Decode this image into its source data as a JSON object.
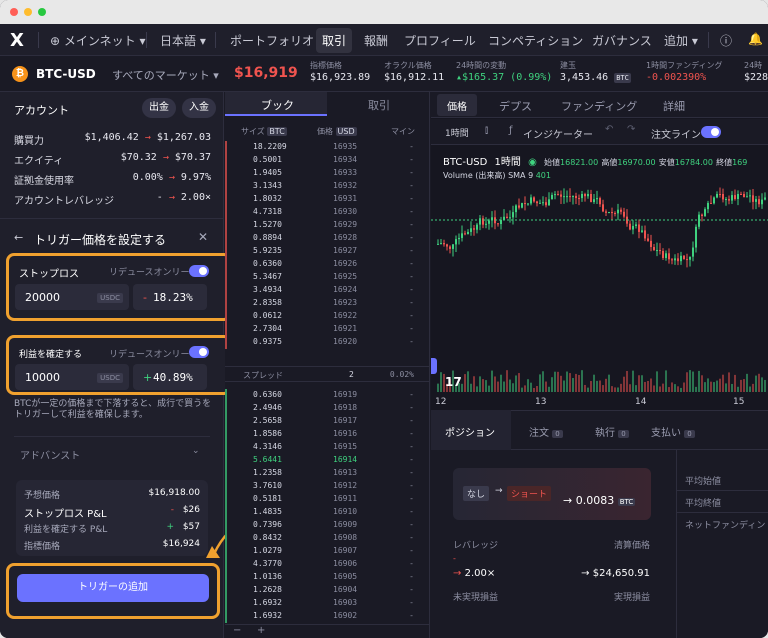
{
  "nav": {
    "network": "メインネット",
    "language": "日本語",
    "items": [
      "ポートフォリオ",
      "取引",
      "報酬",
      "プロフィール",
      "コンペティション",
      "ガバナンス",
      "追加"
    ]
  },
  "ticker": {
    "market": "BTC-USD",
    "all_markets": "すべてのマーケット",
    "price": "$16,919",
    "stats": [
      {
        "label": "指標価格",
        "value": "$16,923.89"
      },
      {
        "label": "オラクル価格",
        "value": "$16,912.11"
      },
      {
        "label": "24時間の変動",
        "value": "▴$165.37 (0.99%)"
      },
      {
        "label": "建玉",
        "value": "3,453.46",
        "unit": "BTC"
      },
      {
        "label": "1時間ファンディング",
        "value": "-0.002390%"
      },
      {
        "label": "24時",
        "value": "$228"
      }
    ]
  },
  "account": {
    "title": "アカウント",
    "withdraw": "出金",
    "deposit": "入金",
    "rows": [
      {
        "k": "購買力",
        "from": "$1,406.42",
        "to": "$1,267.03"
      },
      {
        "k": "エクイティ",
        "from": "$70.32",
        "to": "$70.37"
      },
      {
        "k": "証拠金使用率",
        "from": "0.00%",
        "to": "9.97%"
      },
      {
        "k": "アカウントレバレッジ",
        "from": "-",
        "to": "2.00×"
      }
    ]
  },
  "trigger": {
    "title": "トリガー価格を設定する",
    "stop": {
      "label": "ストップロス",
      "reduce": "リデュースオンリー",
      "value": "20000",
      "unit": "USDC",
      "pct": "18.23%",
      "sign": "-"
    },
    "take": {
      "label": "利益を確定する",
      "reduce": "リデュースオンリー",
      "value": "10000",
      "unit": "USDC",
      "pct": "40.89%",
      "sign": "+"
    },
    "info": "BTCが一定の価格まで下落すると、成行で買うをトリガーして利益を確保します。",
    "advanced": "アドバンスト",
    "summary": [
      {
        "k": "予想価格",
        "v": "$16,918.00"
      },
      {
        "k": "ストップロス P&L",
        "v": "$26",
        "s": "-"
      },
      {
        "k": "利益を確定する P&L",
        "v": "$57",
        "s": "+"
      },
      {
        "k": "指標価格",
        "v": "$16,924"
      }
    ],
    "add": "トリガーの追加"
  },
  "book": {
    "tabs": [
      "ブック",
      "取引"
    ],
    "headers": [
      "サイズ",
      "価格",
      "マイン"
    ],
    "size_unit": "BTC",
    "price_unit": "USD",
    "asks": [
      [
        "18.2209",
        "16935"
      ],
      [
        "0.5001",
        "16934"
      ],
      [
        "1.9405",
        "16933"
      ],
      [
        "3.1343",
        "16932"
      ],
      [
        "1.8032",
        "16931"
      ],
      [
        "4.7318",
        "16930"
      ],
      [
        "1.5270",
        "16929"
      ],
      [
        "0.8894",
        "16928"
      ],
      [
        "5.9235",
        "16927"
      ],
      [
        "0.6360",
        "16926"
      ],
      [
        "5.3467",
        "16925"
      ],
      [
        "3.4934",
        "16924"
      ],
      [
        "2.8358",
        "16923"
      ],
      [
        "0.0612",
        "16922"
      ],
      [
        "2.7304",
        "16921"
      ],
      [
        "0.9375",
        "16920"
      ]
    ],
    "spread": {
      "label": "スプレッド",
      "value": "2",
      "pct": "0.02%"
    },
    "bids": [
      [
        "0.6360",
        "16919"
      ],
      [
        "2.4946",
        "16918"
      ],
      [
        "2.5658",
        "16917"
      ],
      [
        "1.8586",
        "16916"
      ],
      [
        "4.3146",
        "16915"
      ],
      [
        "5.6441",
        "16914"
      ],
      [
        "1.2358",
        "16913"
      ],
      [
        "3.7610",
        "16912"
      ],
      [
        "0.5181",
        "16911"
      ],
      [
        "1.4835",
        "16910"
      ],
      [
        "0.7396",
        "16909"
      ],
      [
        "0.8432",
        "16908"
      ],
      [
        "1.0279",
        "16907"
      ],
      [
        "4.3770",
        "16906"
      ],
      [
        "1.0136",
        "16905"
      ],
      [
        "1.2628",
        "16904"
      ],
      [
        "1.6932",
        "16903"
      ],
      [
        "1.6932",
        "16902"
      ]
    ],
    "dash": "-"
  },
  "chart": {
    "tabs": [
      "価格",
      "デプス",
      "ファンディング",
      "詳細"
    ],
    "interval": "1時間",
    "indicators": "インジケーター",
    "order_lines": "注文ライン",
    "legend": {
      "pair": "BTC-USD",
      "interval": "1時間",
      "open_l": "始値",
      "open": "16821.00",
      "high_l": "高値",
      "high": "16970.00",
      "low_l": "安値",
      "low": "16784.00",
      "close_l": "終値",
      "close": "169"
    },
    "volume": "Volume (出来高) SMA 9",
    "volume_v": "401",
    "x_ticks": [
      "12",
      "13",
      "14",
      "15"
    ]
  },
  "positions": {
    "tabs": [
      {
        "label": "ポジション"
      },
      {
        "label": "注文",
        "n": "0"
      },
      {
        "label": "執行",
        "n": "0"
      },
      {
        "label": "支払い",
        "n": "0"
      }
    ],
    "card": {
      "from": "なし",
      "to": "ショート",
      "size": "0.0083",
      "unit": "BTC"
    },
    "fields": [
      {
        "k": "レバレッジ",
        "v": "2.00×"
      },
      {
        "k": "清算価格",
        "v": "$24,650.91"
      },
      {
        "k": "未実現損益",
        "v": ""
      },
      {
        "k": "実現損益",
        "v": ""
      }
    ],
    "right": [
      "平均始値",
      "平均終値",
      "ネットファンディン"
    ]
  },
  "colors": {
    "accent": "#6b72ff",
    "orange": "#f0a12f",
    "green": "#3fd27f",
    "red": "#f0544f"
  }
}
